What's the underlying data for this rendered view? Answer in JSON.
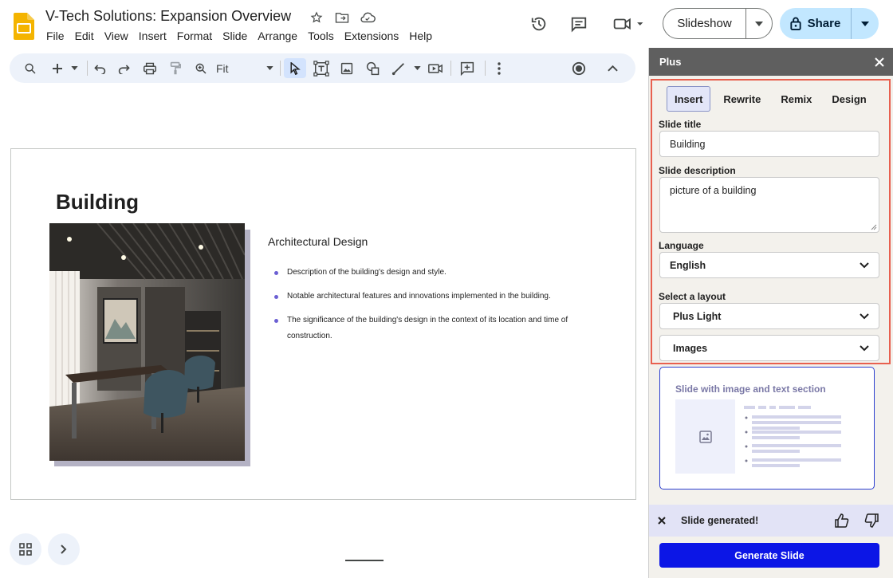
{
  "app": {
    "doc_title": "V-Tech Solutions: Expansion Overview",
    "menu": [
      "File",
      "Edit",
      "View",
      "Insert",
      "Format",
      "Slide",
      "Arrange",
      "Tools",
      "Extensions",
      "Help"
    ],
    "slideshow_label": "Slideshow",
    "share_label": "Share"
  },
  "toolbar": {
    "zoom_value": "Fit"
  },
  "slide": {
    "title": "Building",
    "section_heading": "Architectural Design",
    "bullets": [
      "Description of the building's design and style.",
      "Notable architectural features and innovations implemented in the building.",
      "The significance of the building's design in the context of its location and time of construction."
    ]
  },
  "panel": {
    "title": "Plus",
    "tabs": [
      "Insert",
      "Rewrite",
      "Remix",
      "Design"
    ],
    "active_tab": "Insert",
    "slide_title_label": "Slide title",
    "slide_title_value": "Building",
    "slide_description_label": "Slide description",
    "slide_description_value": "picture of a building",
    "language_label": "Language",
    "language_value": "English",
    "layout_label": "Select a layout",
    "layout_value": "Plus Light",
    "layout_type_value": "Images",
    "layout_card_title": "Slide with image and text section",
    "toast_text": "Slide generated!",
    "generate_button": "Generate Slide"
  },
  "colors": {
    "highlight_border": "#e8604f",
    "generate_button": "#0c16e6",
    "share_bg": "#c2e7ff",
    "bullet_accent": "#6b5fd3"
  },
  "icons": {
    "toolbar": [
      "search-icon",
      "add-icon",
      "undo-icon",
      "redo-icon",
      "print-icon",
      "paint-format-icon",
      "zoom-icon",
      "select-icon",
      "textbox-icon",
      "image-icon",
      "shapes-icon",
      "line-icon",
      "video-icon",
      "comment-add-icon",
      "more-vert-icon",
      "record-icon",
      "collapse-icon"
    ]
  }
}
